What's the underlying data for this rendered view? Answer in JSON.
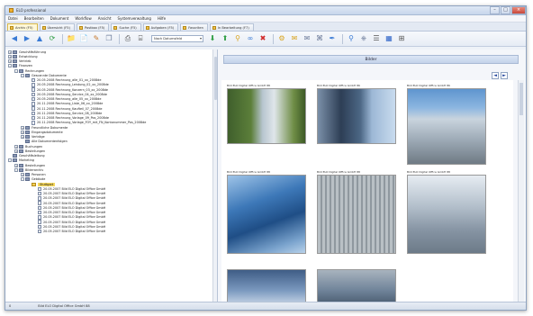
{
  "window": {
    "title": "ELO professional",
    "controls": [
      "–",
      "□",
      "×"
    ]
  },
  "menu": [
    "Datei",
    "Bearbeiten",
    "Dokument",
    "Workflow",
    "Ansicht",
    "Systemverwaltung",
    "Hilfe"
  ],
  "tabs": [
    {
      "label": "Archiv (F5)",
      "active": true
    },
    {
      "label": "Übersicht (F5)",
      "active": false
    },
    {
      "label": "Postbox (F5)",
      "active": false
    },
    {
      "label": "Suche (F5)",
      "active": false
    },
    {
      "label": "Aufgaben (F5)",
      "active": false
    },
    {
      "label": "Favoriten",
      "active": false
    },
    {
      "label": "In Bearbeitung (F7)",
      "active": false
    }
  ],
  "toolbar": {
    "icons": [
      "back-icon",
      "forward-icon",
      "up-icon",
      "refresh-icon",
      "new-folder-icon",
      "new-document-icon",
      "edit-icon",
      "copy-icon",
      "print-icon",
      "scan-icon"
    ],
    "select_value": "Nach Datumsfeld",
    "icons_right": [
      "checkin-icon",
      "checkout-icon",
      "filter-icon",
      "link-icon",
      "delete-icon",
      "workflow-icon",
      "note-icon",
      "mail-icon",
      "attach-icon",
      "pen-icon",
      "zoom-icon",
      "stamp-icon",
      "view-list-icon",
      "view-thumbnail-icon",
      "fit-icon"
    ]
  },
  "tree": [
    {
      "depth": 0,
      "exp": "+",
      "icon": "cabinet",
      "label": "Geschäftsführung"
    },
    {
      "depth": 0,
      "exp": "+",
      "icon": "cabinet",
      "label": "Entwicklung"
    },
    {
      "depth": 0,
      "exp": "+",
      "icon": "cabinet",
      "label": "Vertrieb"
    },
    {
      "depth": 0,
      "exp": "-",
      "icon": "cabinet",
      "label": "Finanzen"
    },
    {
      "depth": 1,
      "exp": "-",
      "icon": "folder",
      "label": "Rechnungen"
    },
    {
      "depth": 2,
      "exp": "-",
      "icon": "folder",
      "label": "Gescannte Dokumente"
    },
    {
      "depth": 3,
      "exp": "",
      "icon": "doc",
      "label": "20.05.2008 Rechnung_alle_01_xx_2008de"
    },
    {
      "depth": 3,
      "exp": "",
      "icon": "doc",
      "label": "20.05.2008 Rechnung_Leistung_02_xx_2008de"
    },
    {
      "depth": 3,
      "exp": "",
      "icon": "doc",
      "label": "20.05.2008 Rechnung_Konzern_03_xx_2008de"
    },
    {
      "depth": 3,
      "exp": "",
      "icon": "doc",
      "label": "20.05.2008 Rechnung_Service_04_xx_2008de"
    },
    {
      "depth": 3,
      "exp": "",
      "icon": "doc",
      "label": "20.05.2008 Rechnung_alle_05_xx_2008de"
    },
    {
      "depth": 3,
      "exp": "",
      "icon": "doc",
      "label": "20.11.2008 Rechnung_Liste_06_xx_2008de"
    },
    {
      "depth": 3,
      "exp": "",
      "icon": "doc",
      "label": "20.11.2008 Rechnung_Kaufteil_07_2008de"
    },
    {
      "depth": 3,
      "exp": "",
      "icon": "doc",
      "label": "20.11.2008 Rechnung_Service_08_2008de"
    },
    {
      "depth": 3,
      "exp": "",
      "icon": "doc",
      "label": "20.11.2008 Rechnung_Vorlage_09_Pos_2008de"
    },
    {
      "depth": 3,
      "exp": "",
      "icon": "doc",
      "label": "20.11.2008 Rechnung_Vorlage_FOY_mit_FN_Kontonummer_Pos_2008de"
    },
    {
      "depth": 2,
      "exp": "+",
      "icon": "folder",
      "label": "Freundliche Dokumente"
    },
    {
      "depth": 2,
      "exp": "+",
      "icon": "folder",
      "label": "Eingangsdokumente"
    },
    {
      "depth": 2,
      "exp": "+",
      "icon": "folder",
      "label": "Verträge"
    },
    {
      "depth": 2,
      "exp": "",
      "icon": "folder",
      "label": "Alle Dokumentenfolgen"
    },
    {
      "depth": 1,
      "exp": "+",
      "icon": "folder",
      "label": "Buchungen"
    },
    {
      "depth": 1,
      "exp": "+",
      "icon": "folder",
      "label": "Bestellungen"
    },
    {
      "depth": 0,
      "exp": "",
      "icon": "cabinet",
      "label": "Geschäftsleitung"
    },
    {
      "depth": 0,
      "exp": "-",
      "icon": "cabinet",
      "label": "Marketing"
    },
    {
      "depth": 1,
      "exp": "+",
      "icon": "folder",
      "label": "Bestellungen"
    },
    {
      "depth": 1,
      "exp": "-",
      "icon": "folder",
      "label": "Bilderarchiv"
    },
    {
      "depth": 2,
      "exp": "+",
      "icon": "folder",
      "label": "Personen"
    },
    {
      "depth": 2,
      "exp": "-",
      "icon": "folder",
      "label": "Gebäude"
    },
    {
      "depth": 3,
      "exp": "",
      "icon": "yellow",
      "label": "Stuttgart",
      "selected": true
    },
    {
      "depth": 4,
      "exp": "",
      "icon": "doc",
      "label": "20.05.2007 Bild ELO Digital Office GmbH"
    },
    {
      "depth": 4,
      "exp": "",
      "icon": "doc",
      "label": "20.05.2007 Bild ELO Digital Office GmbH"
    },
    {
      "depth": 4,
      "exp": "",
      "icon": "doc",
      "label": "20.05.2007 Bild ELO Digital Office GmbH"
    },
    {
      "depth": 4,
      "exp": "",
      "icon": "doc",
      "label": "20.05.2007 Bild ELO Digital Office GmbH"
    },
    {
      "depth": 4,
      "exp": "",
      "icon": "doc",
      "label": "20.05.2007 Bild ELO Digital Office GmbH"
    },
    {
      "depth": 4,
      "exp": "",
      "icon": "doc",
      "label": "20.05.2007 Bild ELO Digital Office GmbH"
    },
    {
      "depth": 4,
      "exp": "",
      "icon": "doc",
      "label": "20.05.2007 Bild ELO Digital Office GmbH"
    },
    {
      "depth": 4,
      "exp": "",
      "icon": "doc",
      "label": "20.05.2007 Bild ELO Digital Office GmbH"
    },
    {
      "depth": 4,
      "exp": "",
      "icon": "doc",
      "label": "20.05.2007 Bild ELO Digital Office GmbH"
    },
    {
      "depth": 4,
      "exp": "",
      "icon": "doc",
      "label": "20.05.2007 Bild ELO Digital Office GmbH"
    }
  ],
  "viewer": {
    "header": "Bilder",
    "nav_prev": "◄",
    "nav_next": "►",
    "thumbnails": [
      {
        "caption": "Bild ELO Digital Office GmbH 88",
        "kind": "sign"
      },
      {
        "caption": "Bild ELO Digital Office GmbH 86",
        "kind": "tower1"
      },
      {
        "caption": "Bild ELO Digital Office GmbH 86",
        "kind": "tower2"
      },
      {
        "caption": "Bild ELO Digital Office GmbH 88",
        "kind": "glass"
      },
      {
        "caption": "Bild ELO Digital Office GmbH 88",
        "kind": "facade"
      },
      {
        "caption": "Bild ELO Digital Office GmbH 88",
        "kind": "tower3"
      },
      {
        "caption": "",
        "kind": "partial1"
      },
      {
        "caption": "",
        "kind": "partial2"
      }
    ]
  },
  "status": {
    "left": "0",
    "text": "Bild ELO Digital Office GmbH 88"
  }
}
